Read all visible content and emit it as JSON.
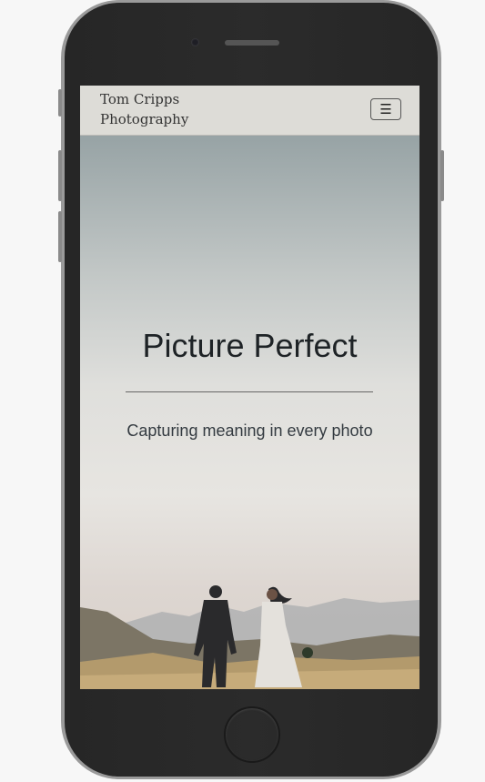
{
  "header": {
    "brand_line1": "Tom Cripps",
    "brand_line2": "Photography",
    "menu_icon": "hamburger-icon"
  },
  "hero": {
    "title": "Picture Perfect",
    "subtitle": "Capturing meaning in every photo"
  }
}
